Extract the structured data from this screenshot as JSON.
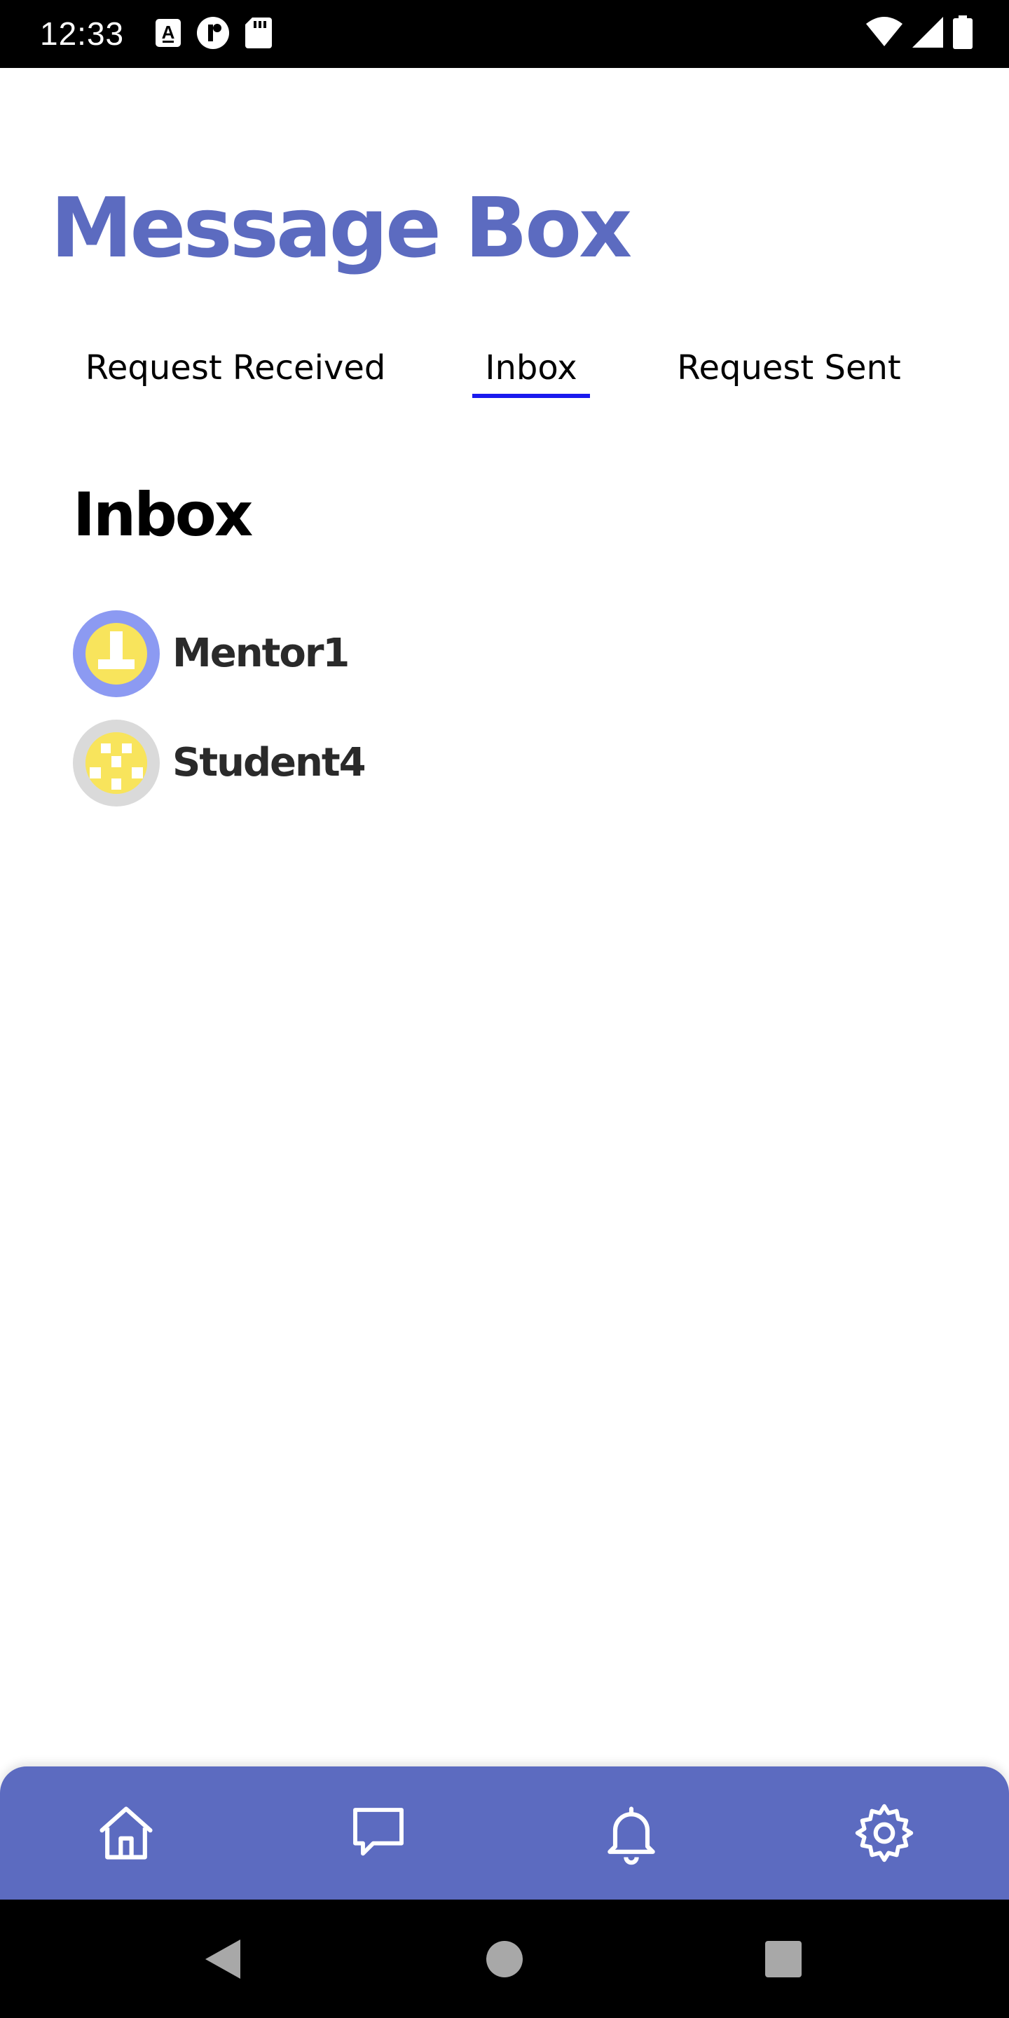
{
  "status_bar": {
    "time": "12:33",
    "icons": [
      "keyboard-a-icon",
      "app-icon",
      "sd-card-icon",
      "wifi-icon",
      "signal-icon",
      "battery-icon"
    ]
  },
  "page": {
    "title": "Message Box",
    "title_color": "#5c6bc0"
  },
  "tabs": {
    "items": [
      {
        "label": "Request Received",
        "active": false
      },
      {
        "label": "Inbox",
        "active": true
      },
      {
        "label": "Request Sent",
        "active": false
      }
    ],
    "underline_color": "#1a1aee"
  },
  "inbox": {
    "heading": "Inbox",
    "items": [
      {
        "name": "Mentor1",
        "avatar_ring": "#8c9af2",
        "avatar_fill": "#f8e45c"
      },
      {
        "name": "Student4",
        "avatar_ring": "#dadada",
        "avatar_fill": "#f8e45c"
      }
    ]
  },
  "bottom_nav": {
    "background": "#5c6bc0",
    "items": [
      "home-icon",
      "chat-icon",
      "bell-icon",
      "settings-icon"
    ]
  },
  "system_nav": {
    "items": [
      "back-icon",
      "home-circle-icon",
      "recents-icon"
    ]
  }
}
